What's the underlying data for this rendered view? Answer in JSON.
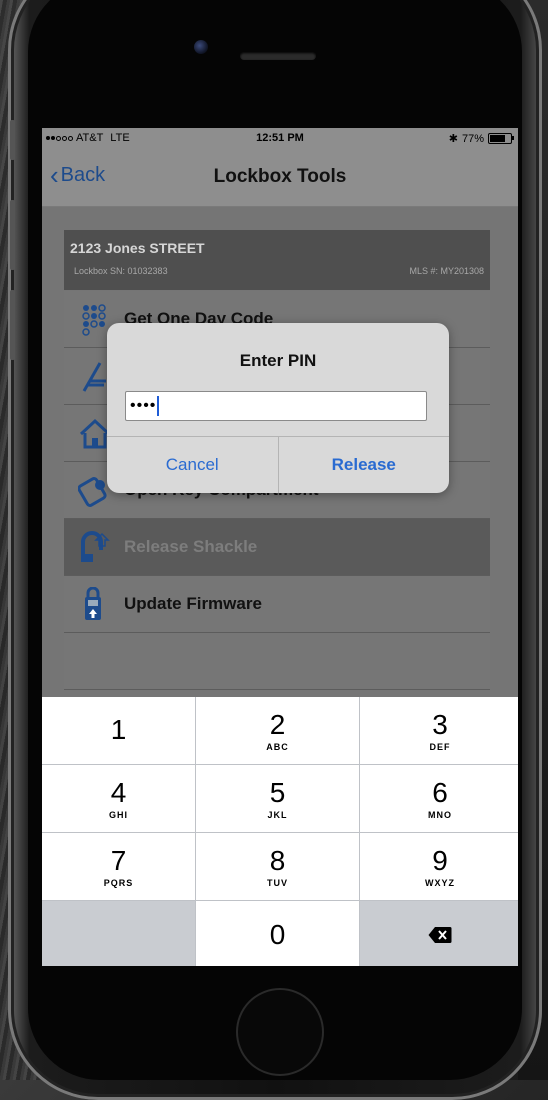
{
  "status_bar": {
    "carrier": "AT&T",
    "network": "LTE",
    "time": "12:51 PM",
    "battery": "77%",
    "bluetooth_icon": "bluetooth-icon"
  },
  "nav": {
    "back_label": "Back",
    "title": "Lockbox Tools"
  },
  "lockbox": {
    "address": "2123 Jones STREET",
    "serial": "Lockbox SN: 01032383",
    "mls": "MLS #: MY201308"
  },
  "menu": [
    {
      "label": "Get One Day Code",
      "icon": "keypad-lock-icon",
      "enabled": true
    },
    {
      "label": "",
      "icon": "sign-icon",
      "enabled": true
    },
    {
      "label": "",
      "icon": "house-icon",
      "enabled": true
    },
    {
      "label": "Open Key Compartment",
      "icon": "key-icon",
      "enabled": true
    },
    {
      "label": "Release Shackle",
      "icon": "shackle-icon",
      "enabled": false
    },
    {
      "label": "Update Firmware",
      "icon": "lockbox-update-icon",
      "enabled": true
    }
  ],
  "dialog": {
    "title": "Enter PIN",
    "pin_value": "••••",
    "cancel_label": "Cancel",
    "release_label": "Release"
  },
  "keypad": {
    "keys": [
      {
        "num": "1",
        "sub": ""
      },
      {
        "num": "2",
        "sub": "ABC"
      },
      {
        "num": "3",
        "sub": "DEF"
      },
      {
        "num": "4",
        "sub": "GHI"
      },
      {
        "num": "5",
        "sub": "JKL"
      },
      {
        "num": "6",
        "sub": "MNO"
      },
      {
        "num": "7",
        "sub": "PQRS"
      },
      {
        "num": "8",
        "sub": "TUV"
      },
      {
        "num": "9",
        "sub": "WXYZ"
      },
      {
        "num": "0",
        "sub": ""
      }
    ],
    "delete_icon": "delete-icon"
  },
  "colors": {
    "ios_blue": "#2a6bd1",
    "icon_blue": "#1d4b8c"
  }
}
